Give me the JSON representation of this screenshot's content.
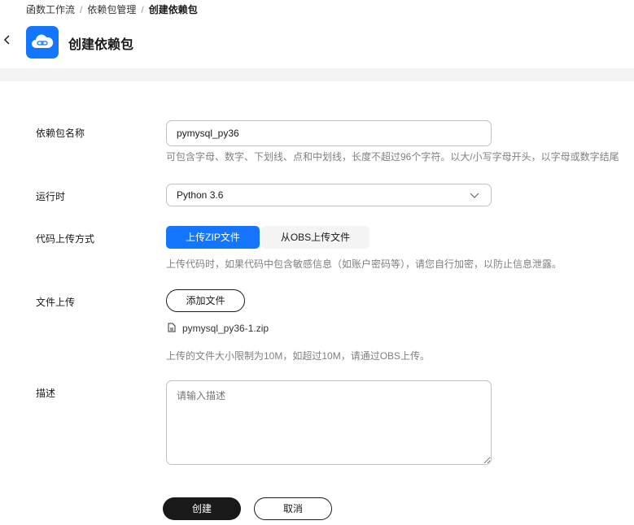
{
  "breadcrumb": [
    "函数工作流",
    "依赖包管理",
    "创建依赖包"
  ],
  "header": {
    "title": "创建依赖包",
    "icon": "cloud-link-icon",
    "accent": "#1476ff"
  },
  "form": {
    "name": {
      "label": "依赖包名称",
      "value": "pymysql_py36",
      "hint": "可包含字母、数字、下划线、点和中划线，长度不超过96个字符。以大/小写字母开头，以字母或数字结尾"
    },
    "runtime": {
      "label": "运行时",
      "value": "Python 3.6"
    },
    "upload_method": {
      "label": "代码上传方式",
      "options": [
        "上传ZIP文件",
        "从OBS上传文件"
      ],
      "selected": "上传ZIP文件",
      "hint": "上传代码时，如果代码中包含敏感信息（如账户密码等），请您自行加密，以防止信息泄露。"
    },
    "file": {
      "label": "文件上传",
      "add_button": "添加文件",
      "filename": "pymysql_py36-1.zip",
      "hint": "上传的文件大小限制为10M，如超过10M，请通过OBS上传。"
    },
    "description": {
      "label": "描述",
      "placeholder": "请输入描述"
    }
  },
  "actions": {
    "create": "创建",
    "cancel": "取消"
  }
}
